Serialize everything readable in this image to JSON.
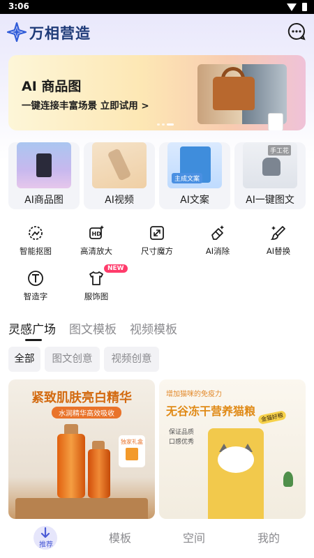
{
  "status_bar": {
    "time": "3:06"
  },
  "header": {
    "title": "万相营造",
    "logo_icon": "logo-sparkle-icon",
    "chat_icon": "chat-bubble-icon"
  },
  "banner": {
    "title": "AI 商品图",
    "subtitle": "一键连接丰富场景 立即试用 >",
    "dots_total": 3,
    "dots_active_index": 2
  },
  "feature_cards": [
    {
      "label": "AI商品图"
    },
    {
      "label": "AI视频"
    },
    {
      "label": "AI文案",
      "image_tag": "主成文案"
    },
    {
      "label": "AI一键图文",
      "image_tag": "手工花"
    }
  ],
  "tools": [
    {
      "label": "智能抠图",
      "icon": "smart-cutout-icon"
    },
    {
      "label": "高清放大",
      "icon": "hd-upscale-icon"
    },
    {
      "label": "尺寸魔方",
      "icon": "resize-icon"
    },
    {
      "label": "AI消除",
      "icon": "eraser-icon"
    },
    {
      "label": "AI替换",
      "icon": "replace-brush-icon"
    },
    {
      "label": "智造字",
      "icon": "text-t-icon"
    },
    {
      "label": "服饰图",
      "icon": "tshirt-icon",
      "badge": "NEW"
    }
  ],
  "tabs": [
    {
      "label": "灵感广场",
      "active": true
    },
    {
      "label": "图文模板",
      "active": false
    },
    {
      "label": "视频模板",
      "active": false
    }
  ],
  "chips": [
    {
      "label": "全部",
      "active": true
    },
    {
      "label": "图文创意",
      "active": false
    },
    {
      "label": "视频创意",
      "active": false
    }
  ],
  "content_cards": [
    {
      "title": "紧致肌肤亮白精华",
      "subtitle": "水润精华高效吸收",
      "gift_label": "独家礼盒"
    },
    {
      "top_text": "增加猫咪的免疫力",
      "title": "无谷冻干营养猫粮",
      "badge": "金猫好粮",
      "items": [
        "保证品质",
        "口感优秀"
      ]
    }
  ],
  "bottom_nav": [
    {
      "label": "推荐",
      "active": true
    },
    {
      "label": "模板",
      "active": false
    },
    {
      "label": "空间",
      "active": false
    },
    {
      "label": "我的",
      "active": false
    }
  ],
  "colors": {
    "brand": "#1e3a78",
    "accent": "#4b5bd6",
    "new_badge": "#ff3b6b"
  }
}
